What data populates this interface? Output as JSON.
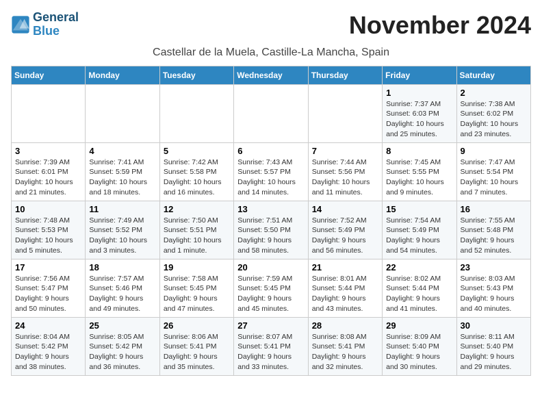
{
  "logo": {
    "line1": "General",
    "line2": "Blue"
  },
  "title": "November 2024",
  "location": "Castellar de la Muela, Castille-La Mancha, Spain",
  "weekdays": [
    "Sunday",
    "Monday",
    "Tuesday",
    "Wednesday",
    "Thursday",
    "Friday",
    "Saturday"
  ],
  "weeks": [
    [
      {
        "day": "",
        "detail": ""
      },
      {
        "day": "",
        "detail": ""
      },
      {
        "day": "",
        "detail": ""
      },
      {
        "day": "",
        "detail": ""
      },
      {
        "day": "",
        "detail": ""
      },
      {
        "day": "1",
        "detail": "Sunrise: 7:37 AM\nSunset: 6:03 PM\nDaylight: 10 hours and 25 minutes."
      },
      {
        "day": "2",
        "detail": "Sunrise: 7:38 AM\nSunset: 6:02 PM\nDaylight: 10 hours and 23 minutes."
      }
    ],
    [
      {
        "day": "3",
        "detail": "Sunrise: 7:39 AM\nSunset: 6:01 PM\nDaylight: 10 hours and 21 minutes."
      },
      {
        "day": "4",
        "detail": "Sunrise: 7:41 AM\nSunset: 5:59 PM\nDaylight: 10 hours and 18 minutes."
      },
      {
        "day": "5",
        "detail": "Sunrise: 7:42 AM\nSunset: 5:58 PM\nDaylight: 10 hours and 16 minutes."
      },
      {
        "day": "6",
        "detail": "Sunrise: 7:43 AM\nSunset: 5:57 PM\nDaylight: 10 hours and 14 minutes."
      },
      {
        "day": "7",
        "detail": "Sunrise: 7:44 AM\nSunset: 5:56 PM\nDaylight: 10 hours and 11 minutes."
      },
      {
        "day": "8",
        "detail": "Sunrise: 7:45 AM\nSunset: 5:55 PM\nDaylight: 10 hours and 9 minutes."
      },
      {
        "day": "9",
        "detail": "Sunrise: 7:47 AM\nSunset: 5:54 PM\nDaylight: 10 hours and 7 minutes."
      }
    ],
    [
      {
        "day": "10",
        "detail": "Sunrise: 7:48 AM\nSunset: 5:53 PM\nDaylight: 10 hours and 5 minutes."
      },
      {
        "day": "11",
        "detail": "Sunrise: 7:49 AM\nSunset: 5:52 PM\nDaylight: 10 hours and 3 minutes."
      },
      {
        "day": "12",
        "detail": "Sunrise: 7:50 AM\nSunset: 5:51 PM\nDaylight: 10 hours and 1 minute."
      },
      {
        "day": "13",
        "detail": "Sunrise: 7:51 AM\nSunset: 5:50 PM\nDaylight: 9 hours and 58 minutes."
      },
      {
        "day": "14",
        "detail": "Sunrise: 7:52 AM\nSunset: 5:49 PM\nDaylight: 9 hours and 56 minutes."
      },
      {
        "day": "15",
        "detail": "Sunrise: 7:54 AM\nSunset: 5:49 PM\nDaylight: 9 hours and 54 minutes."
      },
      {
        "day": "16",
        "detail": "Sunrise: 7:55 AM\nSunset: 5:48 PM\nDaylight: 9 hours and 52 minutes."
      }
    ],
    [
      {
        "day": "17",
        "detail": "Sunrise: 7:56 AM\nSunset: 5:47 PM\nDaylight: 9 hours and 50 minutes."
      },
      {
        "day": "18",
        "detail": "Sunrise: 7:57 AM\nSunset: 5:46 PM\nDaylight: 9 hours and 49 minutes."
      },
      {
        "day": "19",
        "detail": "Sunrise: 7:58 AM\nSunset: 5:45 PM\nDaylight: 9 hours and 47 minutes."
      },
      {
        "day": "20",
        "detail": "Sunrise: 7:59 AM\nSunset: 5:45 PM\nDaylight: 9 hours and 45 minutes."
      },
      {
        "day": "21",
        "detail": "Sunrise: 8:01 AM\nSunset: 5:44 PM\nDaylight: 9 hours and 43 minutes."
      },
      {
        "day": "22",
        "detail": "Sunrise: 8:02 AM\nSunset: 5:44 PM\nDaylight: 9 hours and 41 minutes."
      },
      {
        "day": "23",
        "detail": "Sunrise: 8:03 AM\nSunset: 5:43 PM\nDaylight: 9 hours and 40 minutes."
      }
    ],
    [
      {
        "day": "24",
        "detail": "Sunrise: 8:04 AM\nSunset: 5:42 PM\nDaylight: 9 hours and 38 minutes."
      },
      {
        "day": "25",
        "detail": "Sunrise: 8:05 AM\nSunset: 5:42 PM\nDaylight: 9 hours and 36 minutes."
      },
      {
        "day": "26",
        "detail": "Sunrise: 8:06 AM\nSunset: 5:41 PM\nDaylight: 9 hours and 35 minutes."
      },
      {
        "day": "27",
        "detail": "Sunrise: 8:07 AM\nSunset: 5:41 PM\nDaylight: 9 hours and 33 minutes."
      },
      {
        "day": "28",
        "detail": "Sunrise: 8:08 AM\nSunset: 5:41 PM\nDaylight: 9 hours and 32 minutes."
      },
      {
        "day": "29",
        "detail": "Sunrise: 8:09 AM\nSunset: 5:40 PM\nDaylight: 9 hours and 30 minutes."
      },
      {
        "day": "30",
        "detail": "Sunrise: 8:11 AM\nSunset: 5:40 PM\nDaylight: 9 hours and 29 minutes."
      }
    ]
  ]
}
